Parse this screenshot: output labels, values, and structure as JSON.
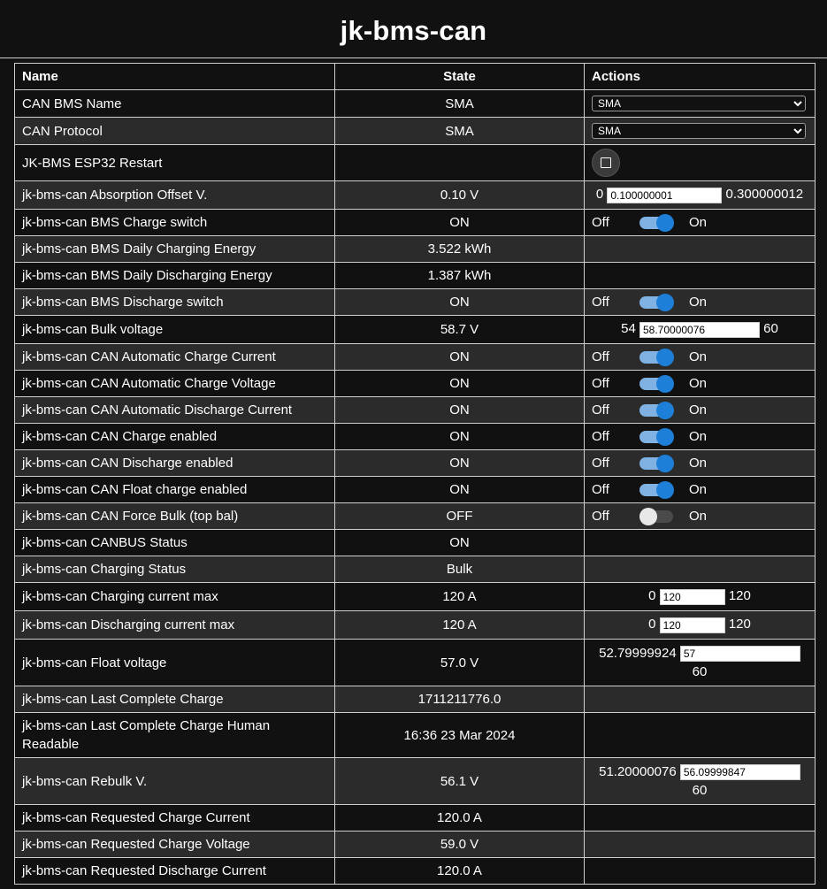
{
  "title": "jk-bms-can",
  "headers": {
    "name": "Name",
    "state": "State",
    "actions": "Actions"
  },
  "rows": [
    {
      "name": "CAN BMS Name",
      "state": "SMA",
      "select": "SMA"
    },
    {
      "name": "CAN Protocol",
      "state": "SMA",
      "select": "SMA"
    },
    {
      "name": "JK-BMS ESP32 Restart",
      "state": ""
    },
    {
      "name": "jk-bms-can Absorption Offset V.",
      "state": "0.10 V",
      "min": "0",
      "value": "0.100000001",
      "max": "0.300000012"
    },
    {
      "name": "jk-bms-can BMS Charge switch",
      "state": "ON",
      "off": "Off",
      "on": "On"
    },
    {
      "name": "jk-bms-can BMS Daily Charging Energy",
      "state": "3.522 kWh"
    },
    {
      "name": "jk-bms-can BMS Daily Discharging Energy",
      "state": "1.387 kWh"
    },
    {
      "name": "jk-bms-can BMS Discharge switch",
      "state": "ON",
      "off": "Off",
      "on": "On"
    },
    {
      "name": "jk-bms-can Bulk voltage",
      "state": "58.7 V",
      "min": "54",
      "value": "58.70000076",
      "max": "60"
    },
    {
      "name": "jk-bms-can CAN Automatic Charge Current",
      "state": "ON",
      "off": "Off",
      "on": "On"
    },
    {
      "name": "jk-bms-can CAN Automatic Charge Voltage",
      "state": "ON",
      "off": "Off",
      "on": "On"
    },
    {
      "name": "jk-bms-can CAN Automatic Discharge Current",
      "state": "ON",
      "off": "Off",
      "on": "On"
    },
    {
      "name": "jk-bms-can CAN Charge enabled",
      "state": "ON",
      "off": "Off",
      "on": "On"
    },
    {
      "name": "jk-bms-can CAN Discharge enabled",
      "state": "ON",
      "off": "Off",
      "on": "On"
    },
    {
      "name": "jk-bms-can CAN Float charge enabled",
      "state": "ON",
      "off": "Off",
      "on": "On"
    },
    {
      "name": "jk-bms-can CAN Force Bulk (top bal)",
      "state": "OFF",
      "off": "Off",
      "on": "On"
    },
    {
      "name": "jk-bms-can CANBUS Status",
      "state": "ON"
    },
    {
      "name": "jk-bms-can Charging Status",
      "state": "Bulk"
    },
    {
      "name": "jk-bms-can Charging current max",
      "state": "120 A",
      "min": "0",
      "value": "120",
      "max": "120"
    },
    {
      "name": "jk-bms-can Discharging current max",
      "state": "120 A",
      "min": "0",
      "value": "120",
      "max": "120"
    },
    {
      "name": "jk-bms-can Float voltage",
      "state": "57.0 V",
      "min": "52.79999924",
      "value": "57",
      "max": "60"
    },
    {
      "name": "jk-bms-can Last Complete Charge",
      "state": "1711211776.0"
    },
    {
      "name": "jk-bms-can Last Complete Charge Human Readable",
      "state": "16:36 23 Mar 2024"
    },
    {
      "name": "jk-bms-can Rebulk V.",
      "state": "56.1 V",
      "min": "51.20000076",
      "value": "56.09999847",
      "max": "60"
    },
    {
      "name": "jk-bms-can Requested Charge Current",
      "state": "120.0 A"
    },
    {
      "name": "jk-bms-can Requested Charge Voltage",
      "state": "59.0 V"
    },
    {
      "name": "jk-bms-can Requested Discharge Current",
      "state": "120.0 A"
    }
  ]
}
